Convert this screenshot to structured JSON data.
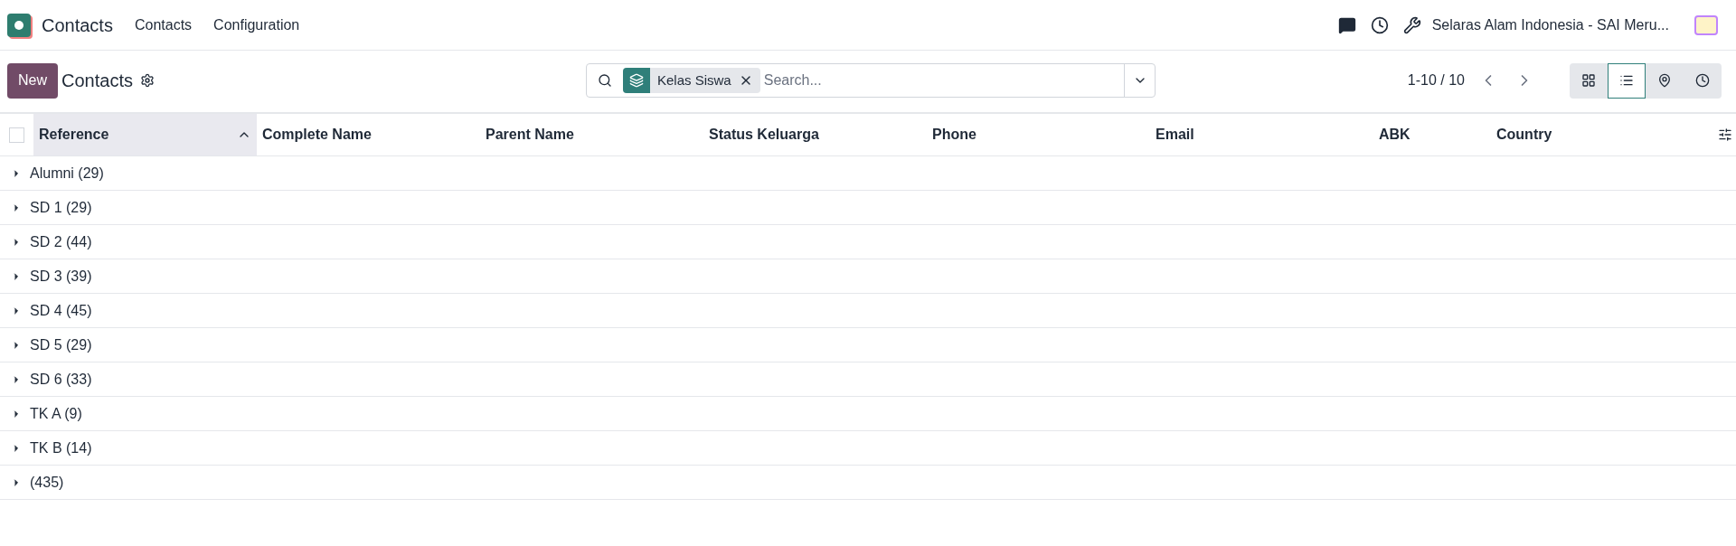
{
  "navbar": {
    "app_name": "Contacts",
    "menu": [
      "Contacts",
      "Configuration"
    ],
    "company": "Selaras Alam Indonesia - SAI Meru..."
  },
  "control_panel": {
    "new_button": "New",
    "title": "Contacts",
    "search": {
      "facet": "Kelas Siswa",
      "placeholder": "Search..."
    },
    "pager": "1-10 / 10",
    "views": [
      {
        "kind": "kanban",
        "selected": false
      },
      {
        "kind": "list",
        "selected": true
      },
      {
        "kind": "map",
        "selected": false
      },
      {
        "kind": "activity",
        "selected": false
      }
    ]
  },
  "table": {
    "select_all_checked": false,
    "columns": [
      {
        "label": "Reference",
        "sorted": true
      },
      {
        "label": "Complete Name",
        "sorted": false
      },
      {
        "label": "Parent Name",
        "sorted": false
      },
      {
        "label": "Status Keluarga",
        "sorted": false
      },
      {
        "label": "Phone",
        "sorted": false
      },
      {
        "label": "Email",
        "sorted": false
      },
      {
        "label": "ABK",
        "sorted": false
      },
      {
        "label": "Country",
        "sorted": false
      }
    ],
    "groups": [
      {
        "label": "Alumni (29)",
        "expanded": false
      },
      {
        "label": "SD 1 (29)",
        "expanded": false
      },
      {
        "label": "SD 2 (44)",
        "expanded": false
      },
      {
        "label": "SD 3 (39)",
        "expanded": false
      },
      {
        "label": "SD 4 (45)",
        "expanded": false
      },
      {
        "label": "SD 5 (29)",
        "expanded": false
      },
      {
        "label": "SD 6 (33)",
        "expanded": false
      },
      {
        "label": "TK A (9)",
        "expanded": false
      },
      {
        "label": "TK B (14)",
        "expanded": false
      },
      {
        "label": "(435)",
        "expanded": false
      }
    ]
  }
}
